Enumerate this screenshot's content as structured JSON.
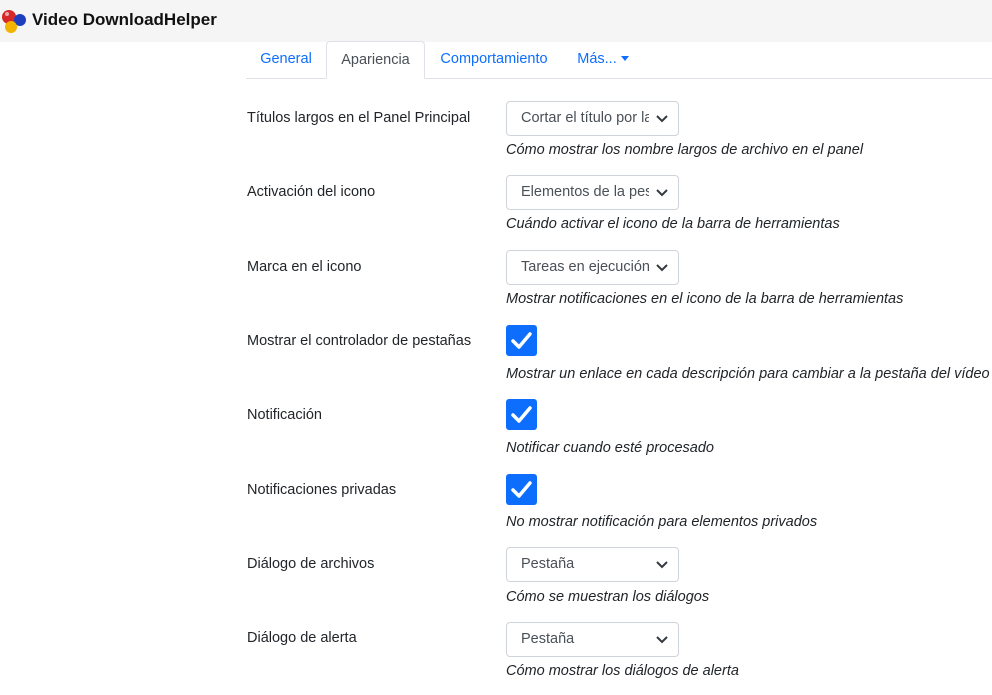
{
  "app": {
    "title": "Video DownloadHelper",
    "logo_icon": "colored-balls-logo-icon"
  },
  "tabs": [
    {
      "label": "General",
      "active": false
    },
    {
      "label": "Apariencia",
      "active": true
    },
    {
      "label": "Comportamiento",
      "active": false
    },
    {
      "label": "Más...",
      "active": false,
      "dropdown": true
    }
  ],
  "settings": [
    {
      "label": "Títulos largos en el Panel Principal",
      "type": "select",
      "value": "Cortar el título por la mitad",
      "description": "Cómo mostrar los nombre largos de archivo en el panel"
    },
    {
      "label": "Activación del icono",
      "type": "select",
      "value": "Elementos de la pestaña",
      "description": "Cuándo activar el icono de la barra de herramientas"
    },
    {
      "label": "Marca en el icono",
      "type": "select",
      "value": "Tareas en ejecución",
      "description": "Mostrar notificaciones en el icono de la barra de herramientas"
    },
    {
      "label": "Mostrar el controlador de pestañas",
      "type": "checkbox",
      "checked": true,
      "description": "Mostrar un enlace en cada descripción para cambiar a la pestaña del vídeo"
    },
    {
      "label": "Notificación",
      "type": "checkbox",
      "checked": true,
      "description": "Notificar cuando esté procesado"
    },
    {
      "label": "Notificaciones privadas",
      "type": "checkbox",
      "checked": true,
      "description": "No mostrar notificación para elementos privados"
    },
    {
      "label": "Diálogo de archivos",
      "type": "select",
      "value": "Pestaña",
      "description": "Cómo se muestran los diálogos"
    },
    {
      "label": "Diálogo de alerta",
      "type": "select",
      "value": "Pestaña",
      "description": "Cómo mostrar los diálogos de alerta"
    }
  ],
  "colors": {
    "accent": "#0d6efd",
    "header_bg": "#f5f5f5",
    "border": "#dee2e6"
  }
}
